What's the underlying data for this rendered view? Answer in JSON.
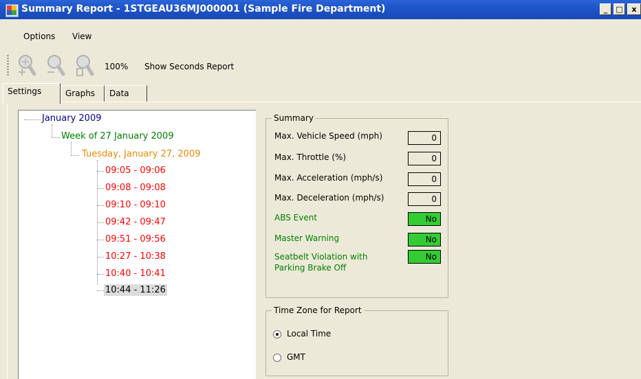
{
  "window": {
    "title": "Summary Report - 1STGEAU36MJ000001 (Sample Fire Department)",
    "controls": {
      "minimize": "_",
      "maximize": "□",
      "close": "x"
    }
  },
  "menu": {
    "items": [
      "Options",
      "View"
    ]
  },
  "toolbar": {
    "icons": [
      "zoom-in-icon",
      "zoom-out-icon",
      "zoom-fit-icon"
    ],
    "zoom_level": "100%",
    "show_seconds_label": "Show Seconds Report"
  },
  "tabs": [
    {
      "label": "Settings",
      "active": true
    },
    {
      "label": "Graphs",
      "active": false
    },
    {
      "label": "Data",
      "active": false
    }
  ],
  "tree": {
    "month": "January 2009",
    "week": "Week of 27 January 2009",
    "day": "Tuesday, January 27, 2009",
    "sessions": [
      "09:05 - 09:06",
      "09:08 - 09:08",
      "09:10 - 09:10",
      "09:42 - 09:47",
      "09:51 - 09:56",
      "10:27 - 10:38",
      "10:40 - 10:41",
      "10:44 - 11:26"
    ],
    "selected_session": "10:44 - 11:26",
    "colors": {
      "month": "#00008b",
      "week": "#008000",
      "day": "#e88a00",
      "session": "#ff0000"
    }
  },
  "summary": {
    "legend": "Summary",
    "rows": [
      {
        "label": "Max. Vehicle Speed (mph)",
        "value": "0"
      },
      {
        "label": "Max. Throttle (%)",
        "value": "0"
      },
      {
        "label": "Max. Acceleration (mph/s)",
        "value": "0"
      },
      {
        "label": "Max. Deceleration (mph/s)",
        "value": "0"
      }
    ],
    "events": [
      {
        "label": "ABS Event",
        "value": "No"
      },
      {
        "label": "Master Warning",
        "value": "No"
      },
      {
        "label": "Seatbelt Violation with",
        "label2": "Parking Brake Off",
        "value": "No"
      }
    ]
  },
  "timezone": {
    "legend": "Time Zone for Report",
    "options": [
      {
        "label": "Local Time",
        "selected": true
      },
      {
        "label": "GMT",
        "selected": false
      }
    ]
  }
}
